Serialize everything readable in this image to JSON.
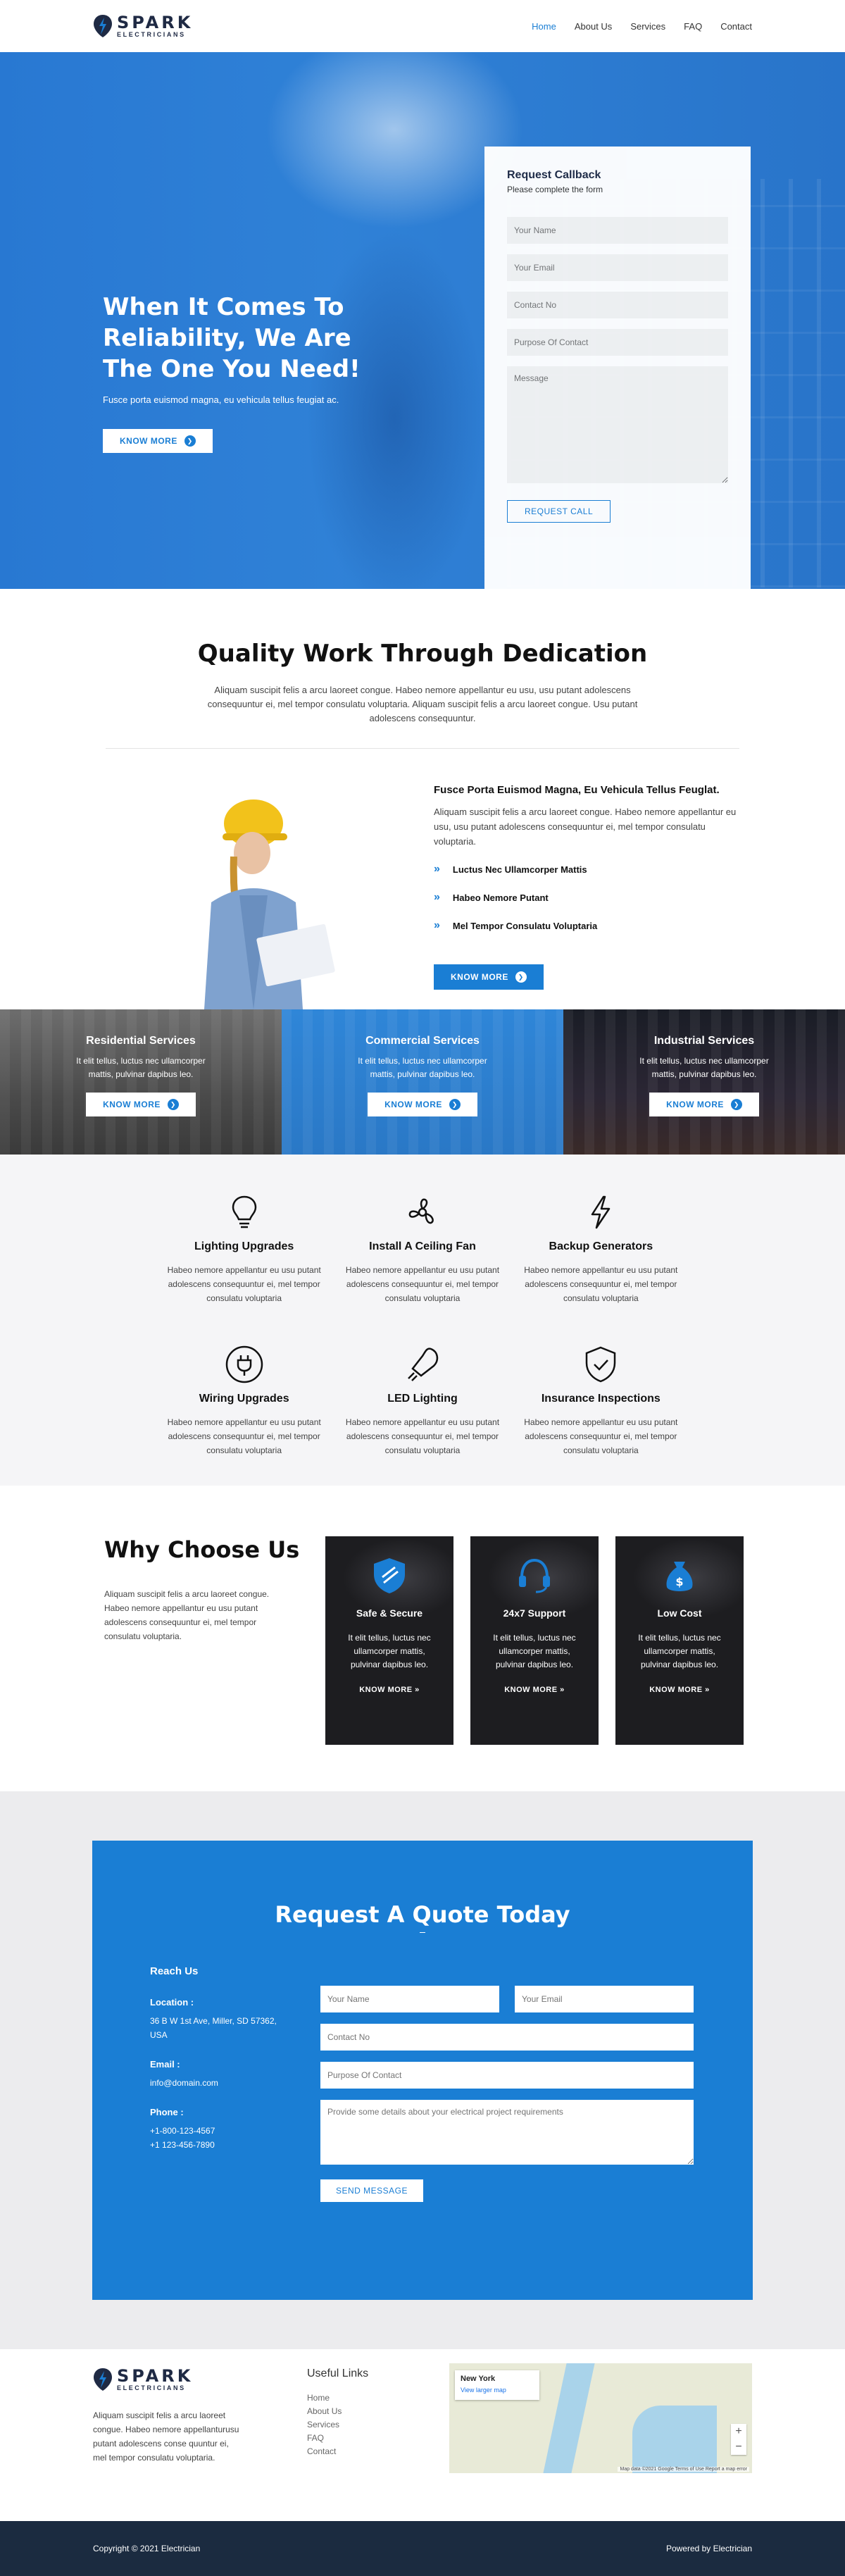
{
  "brand": {
    "name": "SPARK",
    "tagline": "ELECTRICIANS"
  },
  "nav": [
    {
      "label": "Home",
      "active": true
    },
    {
      "label": "About Us"
    },
    {
      "label": "Services"
    },
    {
      "label": "FAQ"
    },
    {
      "label": "Contact"
    }
  ],
  "hero": {
    "title": "When It Comes To Reliability, We Are The One You Need!",
    "subtitle": "Fusce porta euismod magna, eu vehicula tellus feugiat ac.",
    "button": "KNOW MORE"
  },
  "callback": {
    "title": "Request Callback",
    "subtitle": "Please complete the form",
    "name_placeholder": "Your Name",
    "email_placeholder": "Your Email",
    "contact_placeholder": "Contact No",
    "purpose_placeholder": "Purpose Of Contact",
    "message_placeholder": "Message",
    "button": "REQUEST CALL"
  },
  "quality": {
    "title": "Quality Work Through Dedication",
    "text": "Aliquam suscipit felis a arcu laoreet congue. Habeo nemore appellantur eu usu, usu putant adolescens consequuntur ei, mel tempor consulatu voluptaria. Aliquam suscipit felis a arcu laoreet congue. Usu putant adolescens consequuntur."
  },
  "feature": {
    "title": "Fusce Porta Euismod Magna, Eu Vehicula Tellus Feuglat.",
    "text": "Aliquam suscipit felis a arcu laoreet congue. Habeo nemore appellantur eu usu, usu putant adolescens consequuntur ei, mel tempor consulatu voluptaria.",
    "items": [
      "Luctus Nec Ullamcorper Mattis",
      "Habeo Nemore Putant",
      "Mel Tempor Consulatu Voluptaria"
    ],
    "button": "KNOW MORE"
  },
  "services": [
    {
      "title": "Residential Services",
      "text": "It elit tellus, luctus nec ullamcorper mattis, pulvinar dapibus leo.",
      "button": "KNOW MORE"
    },
    {
      "title": "Commercial Services",
      "text": "It elit tellus, luctus nec ullamcorper mattis, pulvinar dapibus leo.",
      "button": "KNOW MORE"
    },
    {
      "title": "Industrial Services",
      "text": "It elit tellus, luctus nec ullamcorper mattis, pulvinar dapibus leo.",
      "button": "KNOW MORE"
    }
  ],
  "grid": [
    {
      "icon": "lightbulb-icon",
      "title": "Lighting Upgrades",
      "text": "Habeo nemore appellantur eu usu putant adolescens consequuntur ei, mel tempor consulatu voluptaria"
    },
    {
      "icon": "ceiling-fan-icon",
      "title": "Install A Ceiling Fan",
      "text": "Habeo nemore appellantur eu usu putant adolescens consequuntur ei, mel tempor consulatu voluptaria"
    },
    {
      "icon": "lightning-icon",
      "title": "Backup Generators",
      "text": "Habeo nemore appellantur eu usu putant adolescens consequuntur ei, mel tempor consulatu voluptaria"
    },
    {
      "icon": "plug-icon",
      "title": "Wiring Upgrades",
      "text": "Habeo nemore appellantur eu usu putant adolescens consequuntur ei, mel tempor consulatu voluptaria"
    },
    {
      "icon": "led-bulb-icon",
      "title": "LED Lighting",
      "text": "Habeo nemore appellantur eu usu putant adolescens consequuntur ei, mel tempor consulatu voluptaria"
    },
    {
      "icon": "shield-check-icon",
      "title": "Insurance Inspections",
      "text": "Habeo nemore appellantur eu usu putant adolescens consequuntur ei, mel tempor consulatu voluptaria"
    }
  ],
  "why": {
    "title": "Why Choose Us",
    "text": "Aliquam suscipit felis a arcu laoreet congue. Habeo nemore appellantur eu usu putant adolescens consequuntur ei, mel tempor consulatu voluptaria.",
    "cards": [
      {
        "icon": "shield-icon",
        "title": "Safe & Secure",
        "text": "It elit tellus, luctus nec ullamcorper mattis, pulvinar dapibus leo.",
        "button": "KNOW MORE"
      },
      {
        "icon": "headset-icon",
        "title": "24x7 Support",
        "text": "It elit tellus, luctus nec ullamcorper mattis, pulvinar dapibus leo.",
        "button": "KNOW MORE"
      },
      {
        "icon": "money-bag-icon",
        "title": "Low Cost",
        "text": "It elit tellus, luctus nec ullamcorper mattis, pulvinar dapibus leo.",
        "button": "KNOW MORE"
      }
    ]
  },
  "quote": {
    "title": "Request A Quote Today",
    "reach_title": "Reach Us",
    "location_label": "Location :",
    "location": "36 B W 1st Ave, Miller, SD 57362, USA",
    "email_label": "Email :",
    "email": "info@domain.com",
    "phone_label": "Phone :",
    "phone1": "+1-800-123-4567",
    "phone2": "+1 123-456-7890",
    "name_placeholder": "Your Name",
    "email_placeholder": "Your Email",
    "contact_placeholder": "Contact No",
    "purpose_placeholder": "Purpose Of Contact",
    "message_placeholder": "Provide some details about your electrical project requirements",
    "button": "SEND MESSAGE"
  },
  "footer": {
    "about": "Aliquam suscipit felis a arcu laoreet congue. Habeo nemore appellanturusu putant adolescens conse quuntur ei, mel tempor consulatu voluptaria.",
    "links_title": "Useful Links",
    "links": [
      "Home",
      "About Us",
      "Services",
      "FAQ",
      "Contact"
    ],
    "map_place": "New York",
    "map_link": "View larger map",
    "map_footer": "Map data ©2021 Google   Terms of Use   Report a map error",
    "copyright": "Copyright © 2021 Electrician",
    "powered": "Powered by Electrician"
  },
  "colors": {
    "accent": "#1a7ed4",
    "dark": "#1b2b40"
  }
}
